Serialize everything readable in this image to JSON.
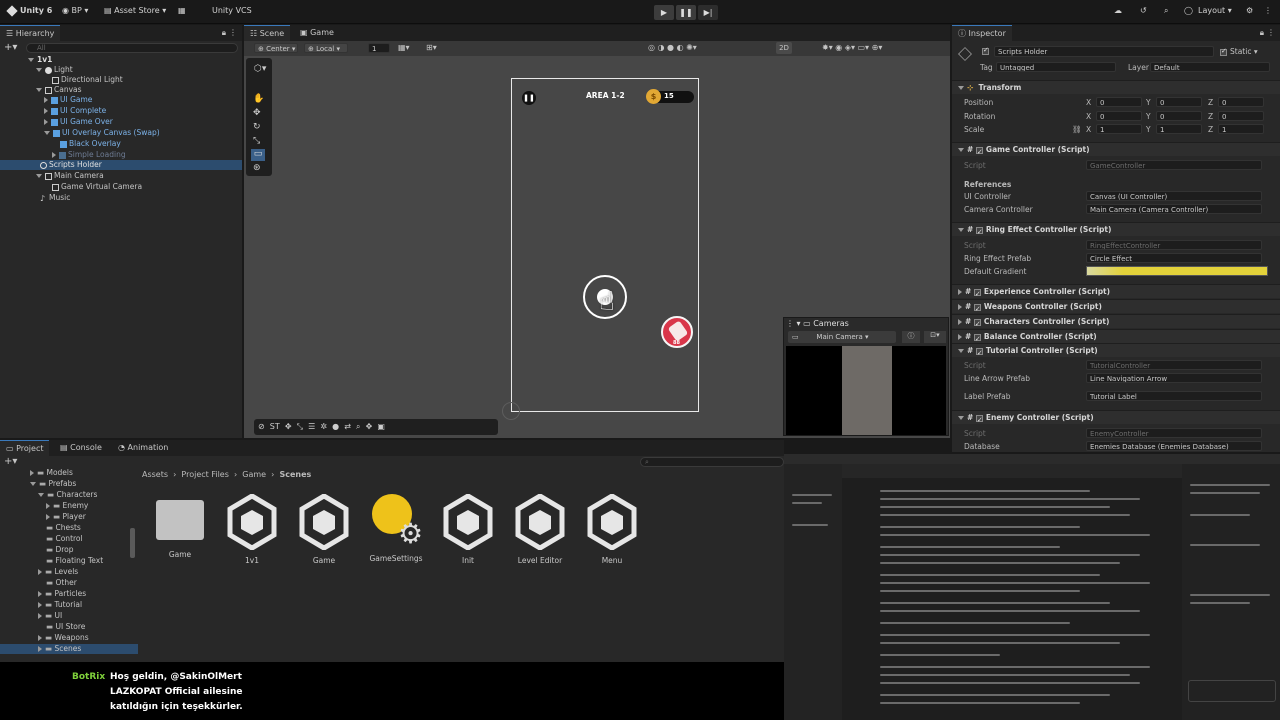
{
  "toolbar": {
    "account": "Unity 6",
    "org": "BP",
    "asset_store": "Asset Store",
    "vcs": "Unity VCS",
    "layout": "Layout"
  },
  "hierarchy": {
    "tab": "Hierarchy",
    "search_placeholder": "All",
    "items": [
      {
        "label": "1v1"
      },
      {
        "label": "Light"
      },
      {
        "label": "Directional Light"
      },
      {
        "label": "Canvas"
      },
      {
        "label": "UI Game"
      },
      {
        "label": "UI Complete"
      },
      {
        "label": "UI Game Over"
      },
      {
        "label": "UI Overlay Canvas (Swap)"
      },
      {
        "label": "Black Overlay"
      },
      {
        "label": "Simple Loading"
      },
      {
        "label": "Scripts Holder"
      },
      {
        "label": "Main Camera"
      },
      {
        "label": "Game Virtual Camera"
      },
      {
        "label": "Music"
      }
    ]
  },
  "scene": {
    "tabs": [
      "Scene",
      "Game"
    ],
    "pivot": "Center",
    "space": "Local",
    "grid_value": "1",
    "mode_2d": "2D",
    "game_area_label": "AREA 1-2",
    "coins": "15",
    "overlay_tools": [
      "ST"
    ],
    "cameras_panel": {
      "title": "Cameras",
      "selected": "Main Camera"
    },
    "enemy_label": "88"
  },
  "inspector": {
    "tab": "Inspector",
    "object_name": "Scripts Holder",
    "static_label": "Static",
    "tag_label": "Tag",
    "tag_value": "Untagged",
    "layer_label": "Layer",
    "layer_value": "Default",
    "transform": {
      "title": "Transform",
      "position_label": "Position",
      "rotation_label": "Rotation",
      "scale_label": "Scale",
      "position": [
        "0",
        "0",
        "0"
      ],
      "rotation": [
        "0",
        "0",
        "0"
      ],
      "scale": [
        "1",
        "1",
        "1"
      ]
    },
    "game_controller": {
      "title": "Game Controller (Script)",
      "script_label": "Script",
      "script_value": "GameController",
      "references_label": "References",
      "ui_controller_label": "UI Controller",
      "ui_controller_value": "Canvas (UI Controller)",
      "camera_controller_label": "Camera Controller",
      "camera_controller_value": "Main Camera (Camera Controller)"
    },
    "ring_effect": {
      "title": "Ring Effect Controller (Script)",
      "script_label": "Script",
      "script_value": "RingEffectController",
      "prefab_label": "Ring Effect Prefab",
      "prefab_value": "Circle Effect",
      "gradient_label": "Default Gradient"
    },
    "collapsed_components": [
      "Experience Controller (Script)",
      "Weapons Controller (Script)",
      "Characters Controller (Script)",
      "Balance Controller (Script)"
    ],
    "tutorial": {
      "title": "Tutorial Controller (Script)",
      "script_label": "Script",
      "script_value": "TutorialController",
      "line_label": "Line Arrow Prefab",
      "line_value": "Line Navigation Arrow",
      "label_label": "Label Prefab",
      "label_value": "Tutorial Label"
    },
    "enemy": {
      "title": "Enemy Controller (Script)",
      "script_label": "Script",
      "script_value": "EnemyController",
      "database_label": "Database",
      "database_value": "Enemies Database (Enemies Database)"
    }
  },
  "project": {
    "tabs": [
      "Project",
      "Console",
      "Animation"
    ],
    "breadcrumb": [
      "Assets",
      "Project Files",
      "Game",
      "Scenes"
    ],
    "tree": [
      "Models",
      "Prefabs",
      "Characters",
      "Enemy",
      "Player",
      "Chests",
      "Control",
      "Drop",
      "Floating Text",
      "Levels",
      "Other",
      "Particles",
      "Tutorial",
      "UI",
      "UI Store",
      "Weapons",
      "Scenes"
    ],
    "assets": [
      "Game",
      "1v1",
      "Game",
      "GameSettings",
      "Init",
      "Level Editor",
      "Menu"
    ]
  },
  "chat": {
    "user": "BotRix",
    "message_line1": "Hoş geldin, @SakinOlMert",
    "message_line2": "LAZKOPAT Official ailesine",
    "message_line3": "katıldığın için teşekkürler."
  },
  "colors": {
    "accent": "#3a79bb",
    "gradient_yellow": "#e3d23a",
    "enemy_red": "#d9364a",
    "coin_gold": "#e2a834",
    "chat_user": "#7fd13b"
  }
}
